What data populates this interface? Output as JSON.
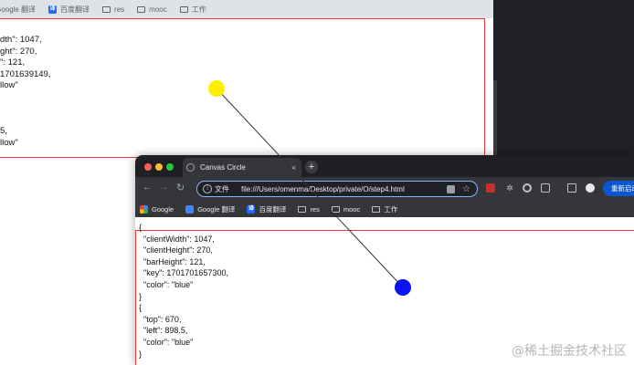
{
  "background_window": {
    "bookmarks": [
      {
        "label": "Google 翻译",
        "icon": "google-translate-icon"
      },
      {
        "label": "百度翻译",
        "icon": "baidu-translate-icon"
      },
      {
        "label": "res",
        "icon": "folder-icon"
      },
      {
        "label": "mooc",
        "icon": "folder-icon"
      },
      {
        "label": "工作",
        "icon": "folder-icon"
      }
    ],
    "json_block_1": "dth\": 1047,\nght\": 270,\n\": 121,\n1701639149,\nllow\"",
    "json_block_2": "5,\nllow\""
  },
  "foreground_window": {
    "tab_title": "Canvas Circle",
    "tab_close": "×",
    "new_tab": "+",
    "nav": {
      "back": "←",
      "forward": "→",
      "reload": "↻"
    },
    "omnibox": {
      "label": "文件",
      "url": "file:///Users/omenma/Desktop/private/O/step4.html"
    },
    "relaunch_button": "重新启动",
    "bookmarks": [
      {
        "label": "Google",
        "icon": "google-icon"
      },
      {
        "label": "Google 翻译",
        "icon": "google-translate-icon"
      },
      {
        "label": "百度翻译",
        "icon": "baidu-translate-icon"
      },
      {
        "label": "res",
        "icon": "folder-icon"
      },
      {
        "label": "mooc",
        "icon": "folder-icon"
      },
      {
        "label": "工作",
        "icon": "folder-icon"
      }
    ],
    "json_output": "{\n  \"clientWidth\": 1047,\n  \"clientHeight\": 270,\n  \"barHeight\": 121,\n  \"key\": 1701701657300,\n  \"color\": \"blue\"\n}\n{\n  \"top\": 670,\n  \"left\": 898.5,\n  \"color\": \"blue\"\n}"
  },
  "circles": [
    {
      "name": "yellow-circle",
      "color": "#ffee00"
    },
    {
      "name": "blue-circle",
      "color": "#0a14f0"
    }
  ],
  "connector_color": "#333333",
  "watermark": "@稀土掘金技术社区"
}
